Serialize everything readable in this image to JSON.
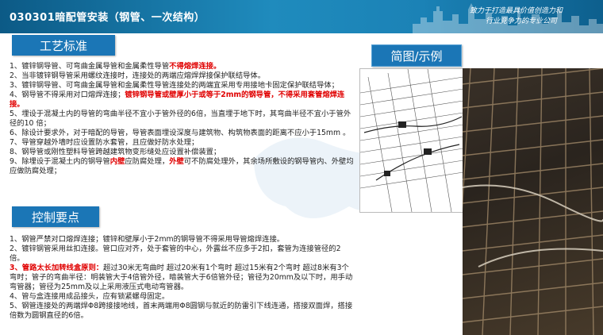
{
  "header": {
    "title": "030301暗配管安装（钢管、一次结构）",
    "slogan_line1": "致力于打造最具价值创造力和",
    "slogan_line2": "行业竞争力的专业公司"
  },
  "sections": {
    "process_label": "工艺标准",
    "figure_label": "简图/示例",
    "control_label": "控制要点"
  },
  "process": {
    "item1_a": "1、镀锌钢导管、可弯曲金属导管和金属柔性导管",
    "item1_red": "不得熔焊连接。",
    "item2": "2、当非镀锌钢导管采用螺纹连接时，连接处的两端应熔焊焊接保护联结导体。",
    "item3": "3、镀锌钢导管、可弯曲金属导管和金属柔性导管连接处的两端宜采用专用接地卡固定保护联结导体；",
    "item4_a": "4、钢导管不得采用对口熔焊连接；",
    "item4_red": "镀锌钢导管或壁厚小于或等于2mm的钢导管，不得采用套管熔焊连接。",
    "item5": "5、埋设于混凝土内的导管的弯曲半径不宜小于管外径的6倍，当直埋于地下时，其弯曲半径不宜小于管外径的10 倍；",
    "item6": "6、除设计要求外，对于暗配的导管，导管表面埋设深度与建筑物、构筑物表面的距离不应小于15mm 。",
    "item7": "7、导管穿越外墙时应设置防水套管，且应做好防水处理；",
    "item8": "8、钢导管或刚性塑料导管跨越建筑物变形缝处应设置补偿装置；",
    "item9_a": "9、除埋设于混凝土内的钢导管",
    "item9_red1": "内壁",
    "item9_b": "应防腐处理，",
    "item9_red2": "外壁",
    "item9_c": "可不防腐处理外，其余场所敷设的钢导管内、外壁均应做防腐处理；"
  },
  "control": {
    "item1": "1、钢管严禁对口熔焊连接；镀锌和壁厚小于2mm的钢导管不得采用导管熔焊连接。",
    "item2": "2、镀锌钢管采用丝扣连接。管口应对齐，处于套管的中心，外露丝不应多于2扣，套管为连接管径的2倍。",
    "item3_red": "3、管路太长加转线盒原则：",
    "item3_b": "超过30米无弯曲时 超过20米有1个弯时 超过15米有2个弯时 超过8米有3个弯时；管子的弯曲半径：明装管大于4倍管外径，暗装管大于6倍管外径；管径为20mm及以下时，用手动弯管器；管径为25mm及以上采用液压式电动弯管器。",
    "item4": "4、管与盒连接用成品接头，应有锁紧螺母固定。",
    "item5": "5、钢管连接处的两端焊Φ8跨接接地线，首末两端用Φ8圆钢与就近的防雷引下线连通，搭接双面焊，搭接倍数为圆钢直径的6倍。"
  },
  "colors": {
    "header_blue": "#1b82b6",
    "label_blue": "#1b76b6",
    "warning_red": "#e00000"
  }
}
